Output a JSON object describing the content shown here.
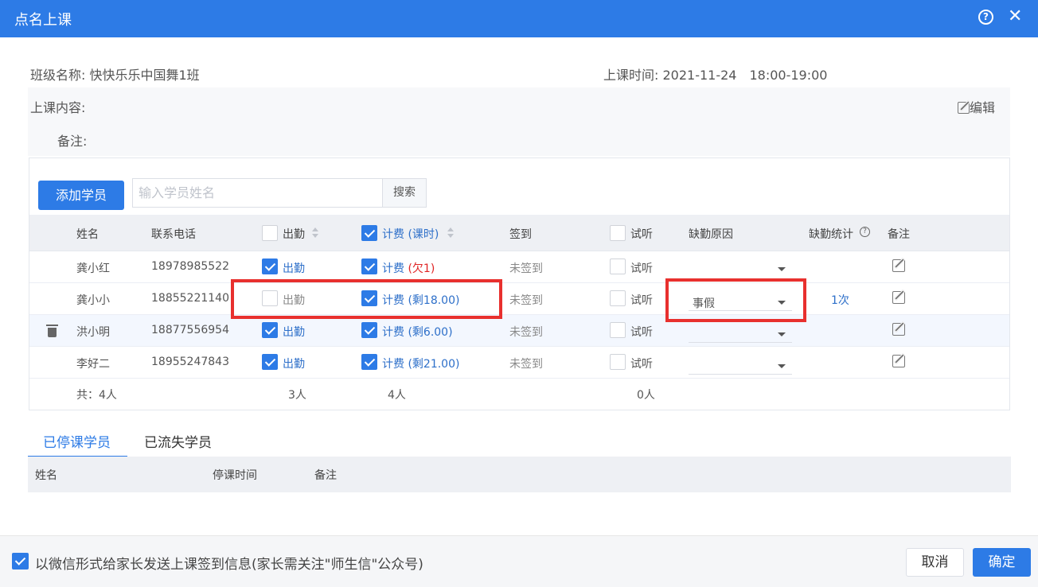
{
  "dialog": {
    "title": "点名上课",
    "help_icon": "question-circle-icon",
    "close_icon": "close-icon"
  },
  "info": {
    "class_label": "班级名称:",
    "class_name": "快快乐乐中国舞1班",
    "time_label": "上课时间:",
    "time_value": "2021-11-24　18:00-19:00",
    "content_label": "上课内容:",
    "note_label": "备注:",
    "edit_label": "编辑"
  },
  "toolbar": {
    "add_label": "添加学员",
    "search_placeholder": "输入学员姓名",
    "search_label": "搜索"
  },
  "table": {
    "headers": {
      "name": "姓名",
      "phone": "联系电话",
      "attend": "出勤",
      "charge": "计费 (课时)",
      "signin": "签到",
      "trial": "试听",
      "reason": "缺勤原因",
      "stats": "缺勤统计",
      "note": "备注"
    },
    "rows": [
      {
        "name": "龚小红",
        "phone": "18978985522",
        "attend_checked": true,
        "attend": "出勤",
        "charge_checked": true,
        "charge_prefix": "计费 ",
        "charge_detail": "(欠1)",
        "signin": "未签到",
        "trial_checked": false,
        "trial": "试听",
        "reason": "",
        "stats": ""
      },
      {
        "name": "龚小小",
        "phone": "18855221140",
        "attend_checked": false,
        "attend": "出勤",
        "charge_checked": true,
        "charge_prefix": "计费 ",
        "charge_detail": "(剩18.00)",
        "signin": "未签到",
        "trial_checked": false,
        "trial": "试听",
        "reason": "事假",
        "stats": "1次"
      },
      {
        "name": "洪小明",
        "phone": "18877556954",
        "attend_checked": true,
        "attend": "出勤",
        "charge_checked": true,
        "charge_prefix": "计费 ",
        "charge_detail": "(剩6.00)",
        "signin": "未签到",
        "trial_checked": false,
        "trial": "试听",
        "reason": "",
        "stats": ""
      },
      {
        "name": "李好二",
        "phone": "18955247843",
        "attend_checked": true,
        "attend": "出勤",
        "charge_checked": true,
        "charge_prefix": "计费 ",
        "charge_detail": "(剩21.00)",
        "signin": "未签到",
        "trial_checked": false,
        "trial": "试听",
        "reason": "",
        "stats": ""
      }
    ],
    "summary": {
      "total": "共：4人",
      "attend": "3人",
      "charge": "4人",
      "trial": "0人"
    }
  },
  "tabs": {
    "suspended": "已停课学员",
    "lost": "已流失学员"
  },
  "suspended_table": {
    "name": "姓名",
    "time": "停课时间",
    "note": "备注"
  },
  "footer": {
    "wechat_checked": true,
    "wechat_text": "以微信形式给家长发送上课签到信息(家长需关注\"师生信\"公众号)",
    "cancel": "取消",
    "ok": "确定"
  },
  "colors": {
    "primary": "#2d7be6",
    "highlight": "#e8302e",
    "debt": "#e02424"
  }
}
